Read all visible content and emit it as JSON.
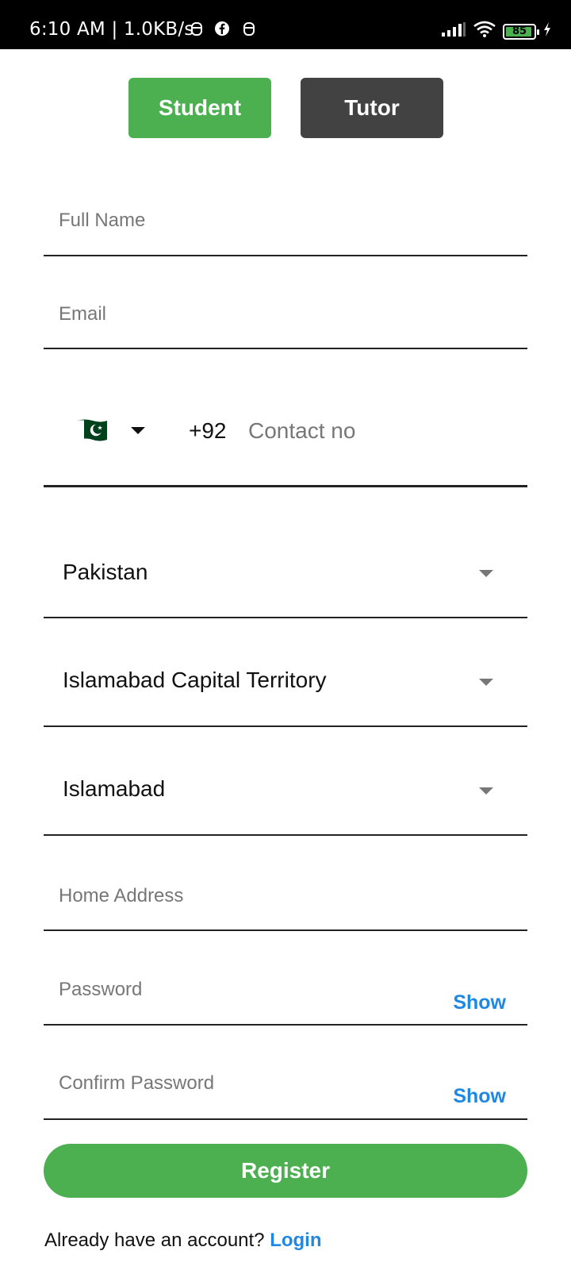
{
  "status_bar": {
    "time_speed": "6:10 AM | 1.0KB/s",
    "battery_level": "85",
    "icons": [
      "notification-icon",
      "facebook-icon",
      "notification-icon",
      "signal-icon",
      "wifi-icon",
      "battery-icon",
      "charging-icon"
    ]
  },
  "roles": {
    "student_label": "Student",
    "tutor_label": "Tutor",
    "selected": "Student"
  },
  "form": {
    "full_name_placeholder": "Full Name",
    "email_placeholder": "Email",
    "phone": {
      "country_flag": "pakistan-flag-icon",
      "dial_code": "+92",
      "placeholder": "Contact no"
    },
    "country_value": "Pakistan",
    "province_value": "Islamabad Capital Territory",
    "city_value": "Islamabad",
    "home_address_placeholder": "Home Address",
    "password_placeholder": "Password",
    "password_show_label": "Show",
    "confirm_password_placeholder": "Confirm Password",
    "confirm_show_label": "Show"
  },
  "register_label": "Register",
  "login_prompt": "Already have an account?",
  "login_link": "Login",
  "colors": {
    "primary_green": "#4caf50",
    "tutor_dark": "#424242",
    "link_blue": "#1e88e5"
  }
}
